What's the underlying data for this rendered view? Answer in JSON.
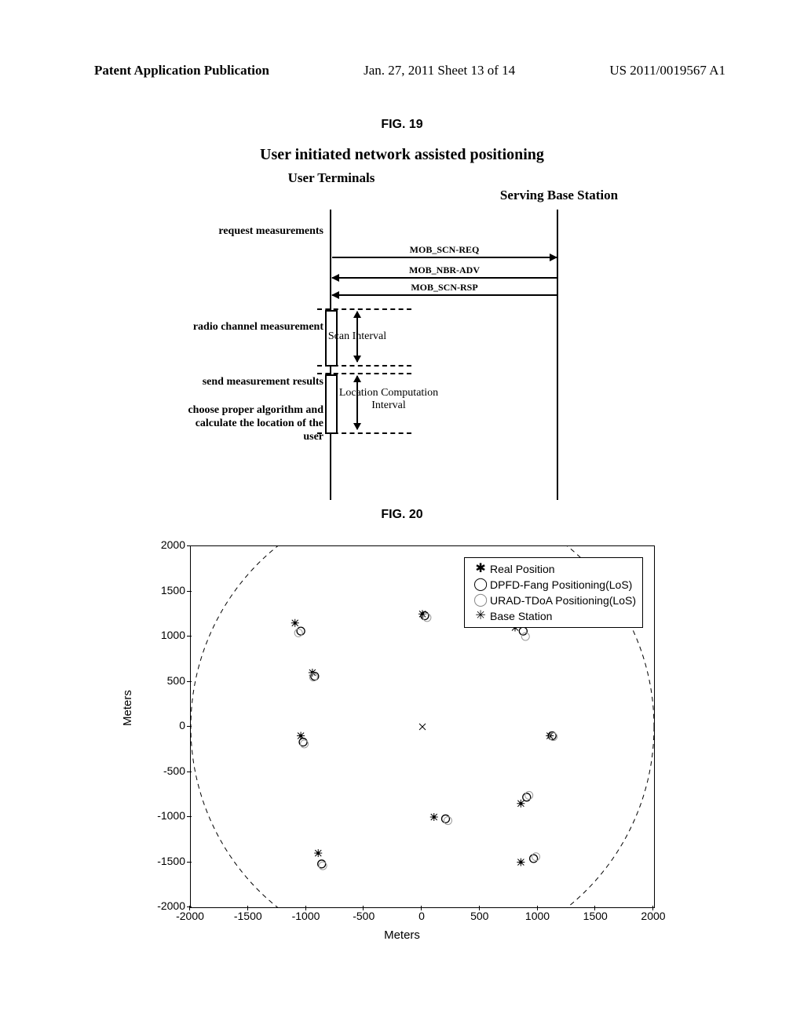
{
  "header": {
    "left": "Patent Application Publication",
    "center": "Jan. 27, 2011  Sheet 13 of 14",
    "right": "US 2011/0019567 A1"
  },
  "fig19": {
    "fig_num": "FIG. 19",
    "title": "User initiated network assisted positioning",
    "actor_ut": "User Terminals",
    "actor_bs": "Serving Base Station",
    "step_request": "request measurements",
    "step_radio": "radio channel measurement",
    "step_send": "send measurement results",
    "step_choose": "choose proper algorithm and calculate the location of the user",
    "msg_scn_req": "MOB_SCN-REQ",
    "msg_nbr_adv": "MOB_NBR-ADV",
    "msg_scn_rsp": "MOB_SCN-RSP",
    "scan_interval": "Scan Interval",
    "loc_interval_line1": "Location Computation",
    "loc_interval_line2": "Interval"
  },
  "fig20": {
    "fig_num": "FIG. 20",
    "xlabel": "Meters",
    "ylabel": "Meters",
    "legend": {
      "real": "Real Position",
      "dpfd": "DPFD-Fang Positioning(LoS)",
      "urad": "URAD-TDoA Positioning(LoS)",
      "bs": "Base Station"
    }
  },
  "chart_data": {
    "type": "scatter",
    "title": "",
    "xlabel": "Meters",
    "ylabel": "Meters",
    "xlim": [
      -2000,
      2000
    ],
    "ylim": [
      -2000,
      2000
    ],
    "x_ticks": [
      -2000,
      -1500,
      -1000,
      -500,
      0,
      500,
      1000,
      1500,
      2000
    ],
    "y_ticks": [
      -2000,
      -1500,
      -1000,
      -500,
      0,
      500,
      1000,
      1500,
      2000
    ],
    "series": [
      {
        "name": "Real Position",
        "marker": "asterisk-dot",
        "points": [
          {
            "x": -1100,
            "y": 1150
          },
          {
            "x": -950,
            "y": 600
          },
          {
            "x": -1050,
            "y": -100
          },
          {
            "x": 0,
            "y": 1250
          },
          {
            "x": 100,
            "y": -1000
          },
          {
            "x": -900,
            "y": -1400
          },
          {
            "x": 800,
            "y": 1100
          },
          {
            "x": 1100,
            "y": -100
          },
          {
            "x": 850,
            "y": -850
          },
          {
            "x": 850,
            "y": -1500
          }
        ]
      },
      {
        "name": "DPFD-Fang Positioning(LoS)",
        "marker": "circle-open-bold",
        "points": [
          {
            "x": -1050,
            "y": 1060
          },
          {
            "x": -930,
            "y": 560
          },
          {
            "x": -1030,
            "y": -170
          },
          {
            "x": 20,
            "y": 1230
          },
          {
            "x": 200,
            "y": -1020
          },
          {
            "x": -870,
            "y": -1520
          },
          {
            "x": 870,
            "y": 1060
          },
          {
            "x": 1120,
            "y": -100
          },
          {
            "x": 900,
            "y": -780
          },
          {
            "x": 960,
            "y": -1460
          }
        ]
      },
      {
        "name": "URAD-TDoA Positioning(LoS)",
        "marker": "circle-open-light",
        "points": [
          {
            "x": -1070,
            "y": 1040
          },
          {
            "x": -940,
            "y": 550
          },
          {
            "x": -1020,
            "y": -190
          },
          {
            "x": 40,
            "y": 1210
          },
          {
            "x": 220,
            "y": -1040
          },
          {
            "x": -860,
            "y": -1540
          },
          {
            "x": 890,
            "y": 1000
          },
          {
            "x": 1130,
            "y": -110
          },
          {
            "x": 920,
            "y": -760
          },
          {
            "x": 980,
            "y": -1440
          }
        ]
      },
      {
        "name": "Base Station",
        "marker": "cross",
        "points": [
          {
            "x": 0,
            "y": 0
          }
        ]
      },
      {
        "name": "cell-boundary",
        "marker": "dashed-circle",
        "cx": 0,
        "cy": 0,
        "r": 2000
      }
    ]
  }
}
